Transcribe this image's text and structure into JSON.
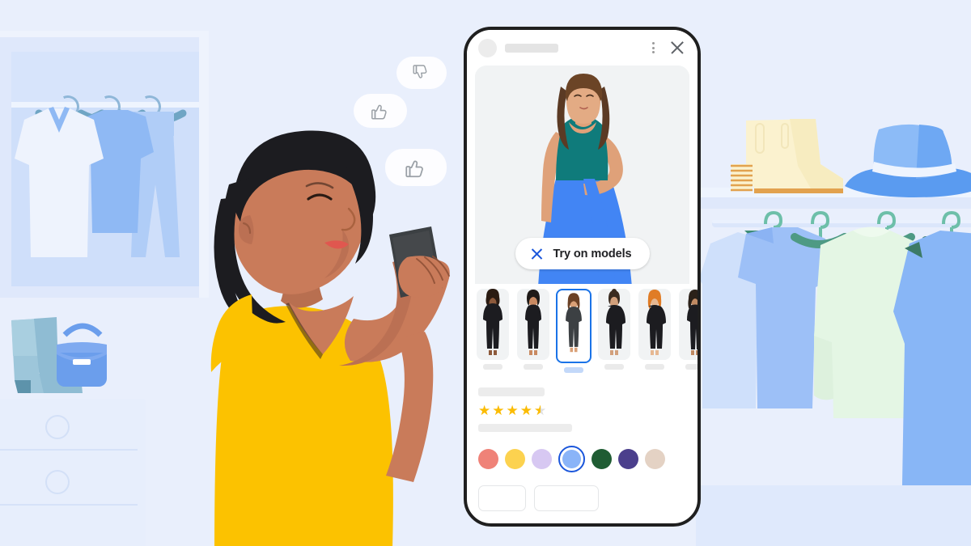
{
  "scene": {
    "title": "Virtual try-on shopping illustration",
    "background_color": "#e9effc"
  },
  "phone": {
    "header": {
      "avatar": "avatar-placeholder",
      "title_placeholder": "",
      "menu_icon": "kebab-menu-icon",
      "close_icon": "close-icon"
    },
    "hero": {
      "model_alt": "model wearing teal tank top and blue skirt",
      "try_on_button": {
        "label": "Try on models",
        "icon": "close-icon",
        "icon_color": "#1a56db"
      }
    },
    "carousel": {
      "selected_index": 2,
      "models": [
        {
          "name": "model-1",
          "skin": "#8d5a3c",
          "hair": "#2a1b12",
          "hair_style": "curly-long"
        },
        {
          "name": "model-2",
          "skin": "#c98a62",
          "hair": "#1f1a17",
          "hair_style": "bob"
        },
        {
          "name": "model-3",
          "skin": "#d9a077",
          "hair": "#6b4126",
          "hair_style": "long-wavy"
        },
        {
          "name": "model-4",
          "skin": "#d2a07c",
          "hair": "#3a2b20",
          "hair_style": "bun"
        },
        {
          "name": "model-5",
          "skin": "#e6b892",
          "hair": "#e07c26",
          "hair_style": "shoulder"
        },
        {
          "name": "model-6",
          "skin": "#c08a63",
          "hair": "#2b2119",
          "hair_style": "long"
        }
      ]
    },
    "product": {
      "name_placeholder": "",
      "rating": 4.5,
      "max_rating": 5,
      "description_placeholder": "",
      "selected_color_index": 3,
      "colors": [
        {
          "name": "salmon",
          "hex": "#ef8278"
        },
        {
          "name": "yellow",
          "hex": "#fcd24f"
        },
        {
          "name": "lavender",
          "hex": "#d7c8f2"
        },
        {
          "name": "blue",
          "hex": "#8ab4f8"
        },
        {
          "name": "dark-green",
          "hex": "#1f5c33"
        },
        {
          "name": "purple",
          "hex": "#4b3f8c"
        },
        {
          "name": "beige",
          "hex": "#e4d2c4"
        }
      ],
      "actions": [
        {
          "name": "primary-action",
          "label": ""
        },
        {
          "name": "secondary-action",
          "label": ""
        }
      ]
    }
  },
  "reactions": [
    {
      "name": "thumbs-down-bubble",
      "icon": "thumbs-down-icon"
    },
    {
      "name": "thumbs-up-bubble-small",
      "icon": "thumbs-up-icon"
    },
    {
      "name": "thumbs-up-bubble-large",
      "icon": "thumbs-up-icon"
    }
  ],
  "person": {
    "name": "woman-with-phone",
    "dress_color": "#fcc200",
    "skin_color": "#c97b5a",
    "hair_color": "#1c1c20",
    "device": "smartphone"
  },
  "room": {
    "left": {
      "wardrobe": "wardrobe",
      "hanging_items": [
        "white-shirt",
        "blue-top",
        "blue-pants"
      ],
      "dresser": "dresser-with-drawers",
      "accessories": [
        "boots",
        "handbag"
      ]
    },
    "right": {
      "shelf_items": [
        "cream-ankle-boot",
        "blue-sun-hat"
      ],
      "hanging_items": [
        "blue-shirt",
        "mint-sweater",
        "blue-garment"
      ]
    }
  }
}
